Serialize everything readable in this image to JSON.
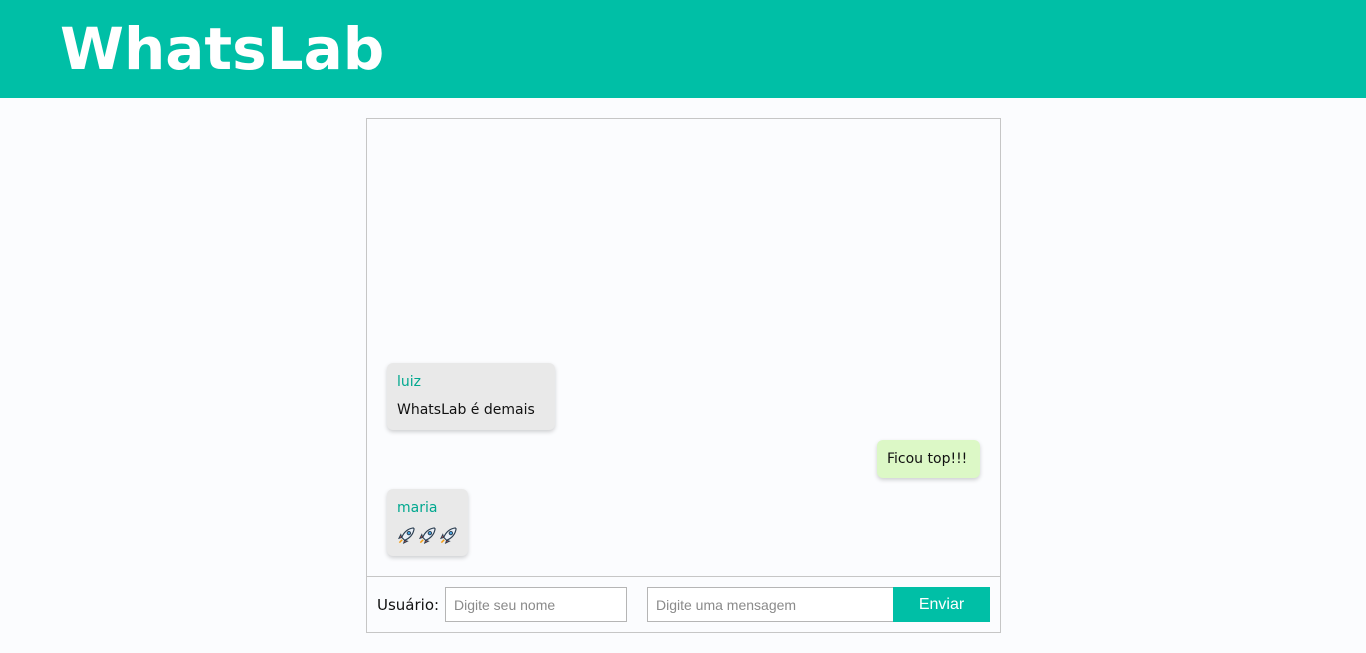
{
  "header": {
    "brand": "WhatsLab",
    "background_color": "#00bfa6"
  },
  "chat": {
    "messages": [
      {
        "author": "luiz",
        "text": "WhatsLab é demais",
        "type": "incoming"
      },
      {
        "author": "",
        "text": "Ficou top!!!",
        "type": "outgoing"
      },
      {
        "author": "maria",
        "text": "",
        "emoji": [
          "rocket-icon",
          "rocket-icon",
          "rocket-icon"
        ],
        "type": "incoming"
      }
    ]
  },
  "compose": {
    "user_label": "Usuário:",
    "user_placeholder": "Digite seu nome",
    "user_value": "",
    "message_placeholder": "Digite uma mensagem",
    "message_value": "",
    "send_label": "Enviar"
  },
  "colors": {
    "accent": "#00bfa6",
    "incoming_bubble": "#e9e9e9",
    "outgoing_bubble": "#dcf8c6",
    "author": "#00a88f"
  }
}
